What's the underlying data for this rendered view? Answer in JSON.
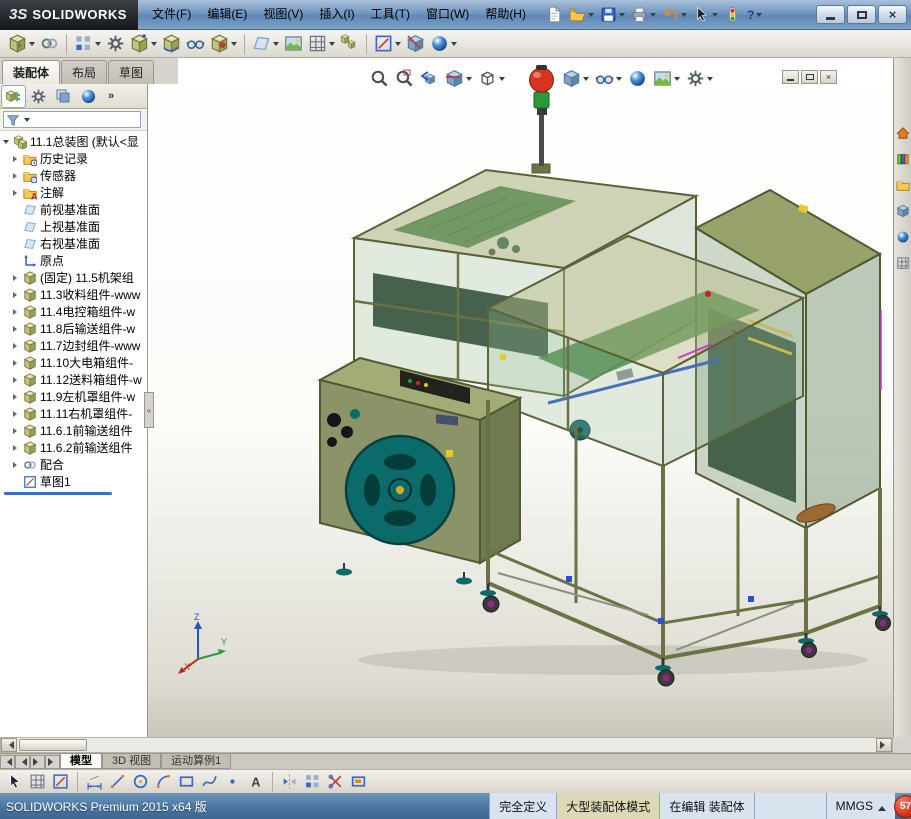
{
  "titlebar": {
    "logo_mark": "3S",
    "logo_text": "SOLIDWORKS",
    "menus": [
      "文件(F)",
      "编辑(E)",
      "视图(V)",
      "插入(I)",
      "工具(T)",
      "窗口(W)",
      "帮助(H)"
    ],
    "quick_tools": [
      "新建",
      "打开",
      "保存",
      "打印",
      "撤销",
      "选择",
      "重建模型",
      "帮助"
    ],
    "window_controls": [
      "最小化",
      "最大化",
      "关闭"
    ]
  },
  "assembly_toolbar": {
    "tools": [
      "插入零部件",
      "配合",
      "线性零部件阵列",
      "智能扣件",
      "移动零部件",
      "旋转零部件",
      "显示隐藏的零部件",
      "装配体特征",
      "参考几何体",
      "新建运动算例",
      "材料明细表",
      "爆炸视图",
      "爆炸直线草图",
      "干涉检查",
      "外观"
    ]
  },
  "command_tabs": {
    "items": [
      "装配体",
      "布局",
      "草图"
    ]
  },
  "feature_manager": {
    "tabs": [
      "FeatureManager设计树",
      "PropertyManager",
      "ConfigurationManager",
      "DisplayManager"
    ],
    "overflow": "»",
    "items": [
      {
        "label": "11.1总装图 (默认<显"
      },
      {
        "label": "历史记录"
      },
      {
        "label": "传感器"
      },
      {
        "label": "注解"
      },
      {
        "label": "前视基准面"
      },
      {
        "label": "上视基准面"
      },
      {
        "label": "右视基准面"
      },
      {
        "label": "原点"
      },
      {
        "label": "(固定) 11.5机架组"
      },
      {
        "label": "11.3收料组件-www"
      },
      {
        "label": "11.4电控箱组件-w"
      },
      {
        "label": "11.8后输送组件-w"
      },
      {
        "label": "11.7边封组件-www"
      },
      {
        "label": "11.10大电箱组件-"
      },
      {
        "label": "11.12送料箱组件-w"
      },
      {
        "label": "11.9左机罩组件-w"
      },
      {
        "label": "11.11右机罩组件-"
      },
      {
        "label": "11.6.1前输送组件"
      },
      {
        "label": "11.6.2前输送组件"
      },
      {
        "label": "配合"
      },
      {
        "label": "草图1"
      }
    ]
  },
  "viewport": {
    "heads_up_tools": [
      "整屏显示全图",
      "局部放大",
      "上一视图",
      "剖面视图",
      "视图定向",
      "显示样式",
      "隐藏/显示项目",
      "编辑外观",
      "应用布景",
      "视图设定"
    ],
    "doc_controls": [
      "最小化",
      "还原",
      "关闭"
    ],
    "triad": {
      "x": "X",
      "y": "Y",
      "z": "Z"
    }
  },
  "task_pane": {
    "tools": [
      "SOLIDWORKS资源",
      "设计库",
      "文件探索器",
      "视图调色板",
      "外观、布景和贴图",
      "自定义属性"
    ]
  },
  "model_tabs": {
    "items": [
      "模型",
      "3D 视图",
      "运动算例1"
    ]
  },
  "sketch_toolbar": {
    "tools": [
      "选择",
      "网格系统",
      "草图绘制",
      "智能尺寸",
      "直线",
      "圆",
      "圆弧",
      "矩形",
      "样条曲线",
      "点",
      "文本",
      "镜向实体",
      "线性草图阵列",
      "剪裁实体",
      "转换实体引用"
    ]
  },
  "statusbar": {
    "app_label": "SOLIDWORKS Premium 2015 x64 版",
    "define_state": "完全定义",
    "assembly_mode": "大型装配体模式",
    "edit_state": "在编辑 装配体",
    "units": "MMGS",
    "resource_badge": "57"
  },
  "model_colors": {
    "frame_olive": "#6b7346",
    "glass_green": "#9fb37c",
    "reel_teal": "#0b6b6b",
    "signal_red": "#d83520",
    "signal_green": "#2a9a3a",
    "caster_purple": "#8a2a8a"
  }
}
